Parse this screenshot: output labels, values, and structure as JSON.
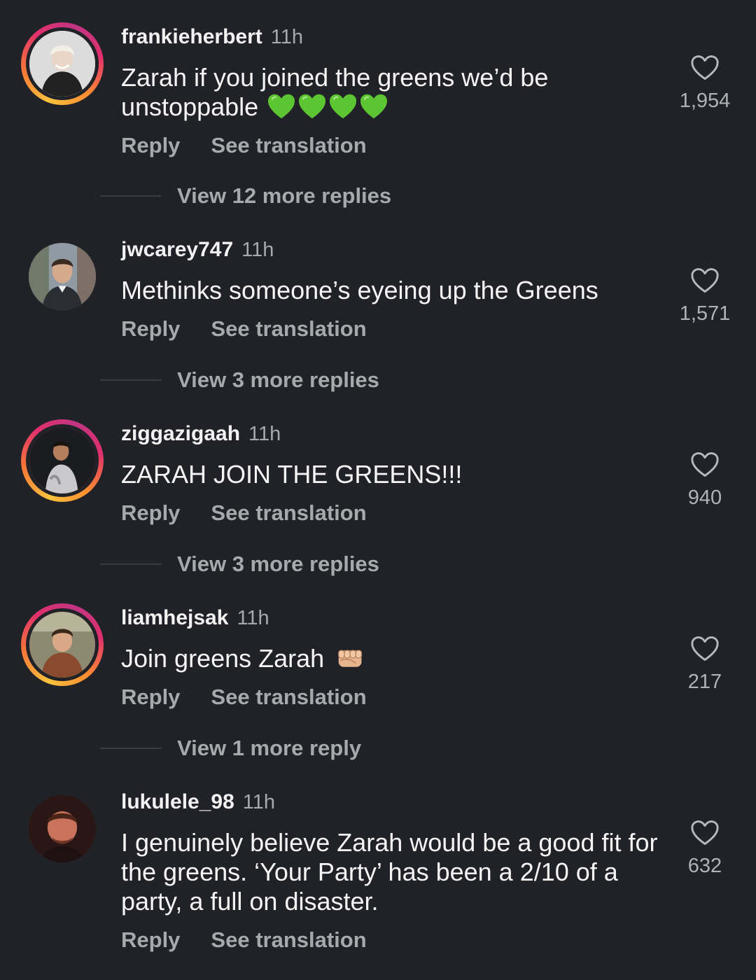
{
  "comments": [
    {
      "username": "frankieherbert",
      "time": "11h",
      "text": "Zarah if you joined the greens we’d be unstoppable",
      "emoji": "green-heart x4",
      "likes": "1,954",
      "reply": "Reply",
      "translate": "See translation",
      "view_more": "View 12 more replies",
      "story_ring": true
    },
    {
      "username": "jwcarey747",
      "time": "11h",
      "text": "Methinks someone’s eyeing up the Greens",
      "likes": "1,571",
      "reply": "Reply",
      "translate": "See translation",
      "view_more": "View 3 more replies",
      "story_ring": false
    },
    {
      "username": "ziggazigaah",
      "time": "11h",
      "text": "ZARAH JOIN THE GREENS!!!",
      "likes": "940",
      "reply": "Reply",
      "translate": "See translation",
      "view_more": "View 3 more replies",
      "story_ring": true
    },
    {
      "username": "liamhejsak",
      "time": "11h",
      "text": "Join greens Zarah",
      "emoji": "oncoming-fist",
      "likes": "217",
      "reply": "Reply",
      "translate": "See translation",
      "view_more": "View 1 more reply",
      "story_ring": true
    },
    {
      "username": "lukulele_98",
      "time": "11h",
      "text": "I genuinely believe Zarah would be a good fit for the greens. ‘Your Party’ has been a 2/10 of a party, a full on disaster.",
      "likes": "632",
      "reply": "Reply",
      "translate": "See translation",
      "story_ring": false
    }
  ],
  "colors": {
    "background": "#212227",
    "secondary_text": "#a7a9ad",
    "primary_text": "#f5f5f5",
    "green_heart": "#5cc532"
  }
}
